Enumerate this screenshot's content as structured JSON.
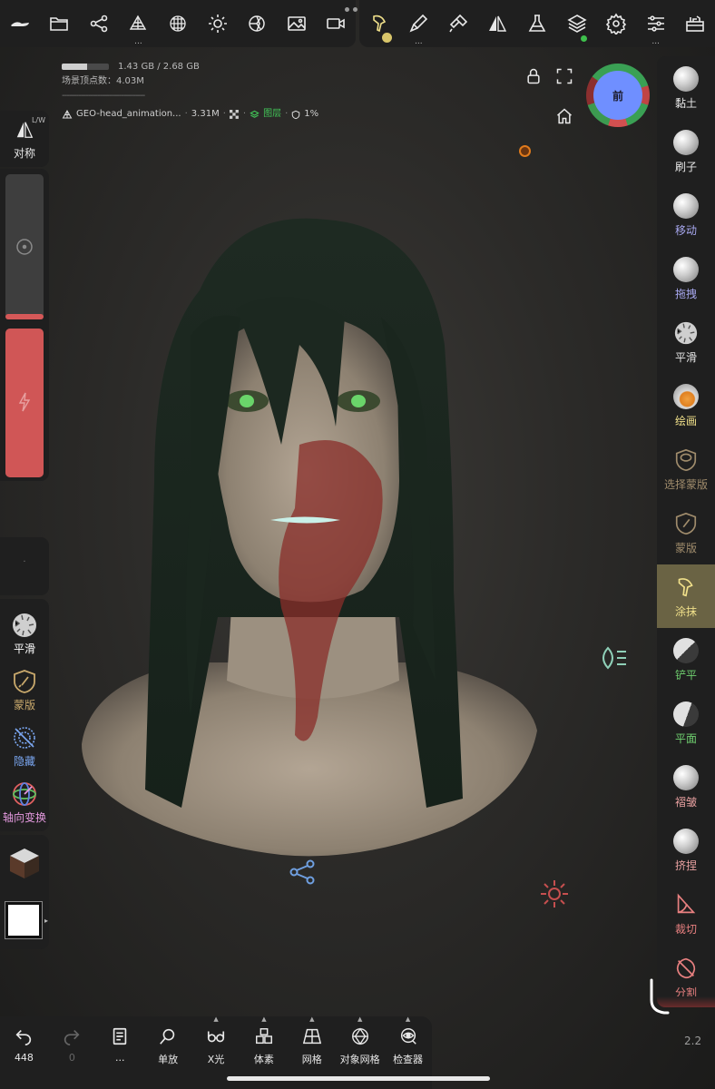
{
  "topbar": {
    "left": [
      "home-icon",
      "folder-icon",
      "scene-graph-icon",
      "mesh-icon",
      "sphere-grid-icon",
      "light-icon",
      "shading-icon",
      "background-icon",
      "camera-icon"
    ],
    "right": [
      "smudge-tool-icon",
      "paint-icon",
      "painting-icon",
      "symmetry-icon",
      "flask-icon",
      "layers-icon",
      "settings-icon",
      "sliders-icon",
      "toolbox-icon"
    ]
  },
  "stats": {
    "memory": "1.43 GB / 2.68 GB",
    "memory_fraction": 0.53,
    "vertices": "场景顶点数：4.03M",
    "dashes": "-----------------------------------",
    "object_name": "GEO-head_animation...",
    "object_verts": "3.31M",
    "layers": "图层",
    "mask_percent": "1%"
  },
  "gizmo": {
    "face": "前"
  },
  "left": {
    "symmetry": {
      "lw": "L/W",
      "label": "对称"
    },
    "size_fraction": 0.04,
    "intensity_fraction": 1.0,
    "empty_dot": "·",
    "tools": [
      {
        "label": "平滑",
        "color": "#ffffff"
      },
      {
        "label": "蒙版",
        "color": "#c9a96c"
      },
      {
        "label": "隐藏",
        "color": "#7aa6f0"
      },
      {
        "label": "轴向变换",
        "color": "#e59ae0"
      }
    ]
  },
  "right": {
    "tools": [
      {
        "label": "黏土",
        "color": "#ffffff"
      },
      {
        "label": "刷子",
        "color": "#ffffff"
      },
      {
        "label": "移动",
        "color": "#a8a8f0"
      },
      {
        "label": "拖拽",
        "color": "#a8a8f0"
      },
      {
        "label": "平滑",
        "color": "#ffffff"
      },
      {
        "label": "绘画",
        "color": "#f0e08a"
      },
      {
        "label": "选择蒙版",
        "color": "#a08c6c"
      },
      {
        "label": "蒙版",
        "color": "#a08c6c"
      },
      {
        "label": "涂抹",
        "color": "#f0e08a"
      },
      {
        "label": "铲平",
        "color": "#6fd06f"
      },
      {
        "label": "平面",
        "color": "#6fd06f"
      },
      {
        "label": "褶皱",
        "color": "#e8a0a0"
      },
      {
        "label": "挤捏",
        "color": "#e8a0a0"
      },
      {
        "label": "裁切",
        "color": "#e88080"
      },
      {
        "label": "分割",
        "color": "#e88080"
      }
    ],
    "active_index": 8
  },
  "bottom": [
    {
      "label": "448",
      "icon": "undo-icon"
    },
    {
      "label": "0",
      "icon": "redo-icon"
    },
    {
      "label": "...",
      "icon": "book-icon"
    },
    {
      "label": "单放",
      "icon": "search-icon"
    },
    {
      "label": "X光",
      "icon": "glasses-icon"
    },
    {
      "label": "体素",
      "icon": "voxel-icon"
    },
    {
      "label": "网格",
      "icon": "grid-icon"
    },
    {
      "label": "对象网格",
      "icon": "object-mesh-icon"
    },
    {
      "label": "检查器",
      "icon": "inspector-icon"
    }
  ],
  "version": "2.2"
}
